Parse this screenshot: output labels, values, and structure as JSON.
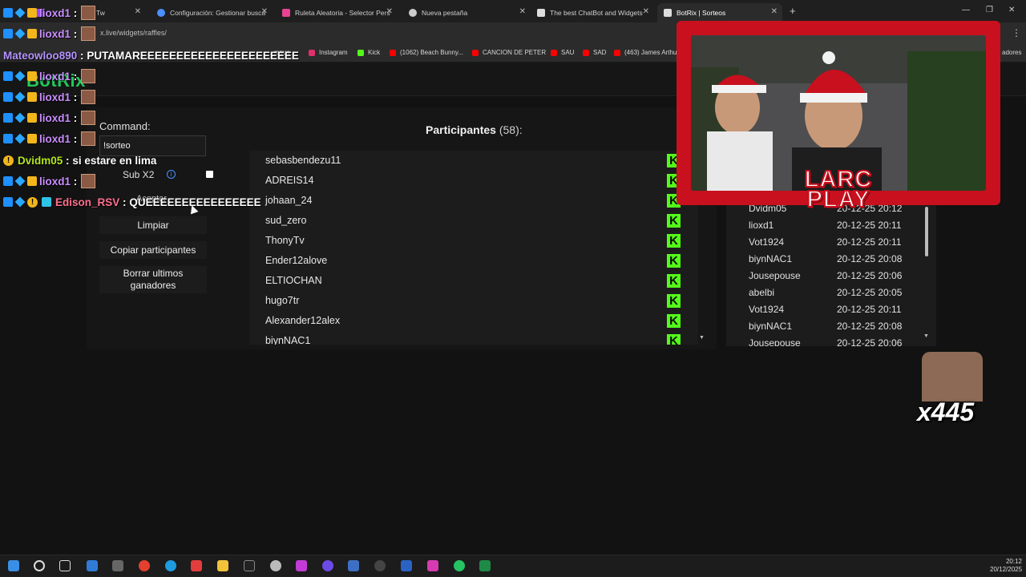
{
  "browser": {
    "tabs": [
      {
        "label": "Tw",
        "color": "#9146ff"
      },
      {
        "label": "Configuración: Gestionar busca",
        "color": "#4a90ff"
      },
      {
        "label": "Ruleta Aleatoria - Selector Pers",
        "color": "#e84393"
      },
      {
        "label": "Nueva pestaña",
        "color": "#cccccc"
      },
      {
        "label": "The best ChatBot and Widgets",
        "color": "#dddddd"
      },
      {
        "label": "BotRix | Sorteos",
        "color": "#dddddd"
      }
    ],
    "url": "x.live/widgets/raffles/",
    "bookmarks": [
      "mpus",
      "Instagram",
      "Kick",
      "(1062) Beach Bunny...",
      "CANCION DE PETER",
      "SAU",
      "SAD",
      "(463) James Arthu",
      "adores"
    ]
  },
  "app": {
    "logo": "BotRix",
    "command_label": "Command:",
    "command_value": "!sorteo",
    "subx2_label": "Sub X2",
    "info_icon": "i",
    "aceptar_label": "Aceptar",
    "limpiar_label": "Limpiar",
    "copiar_label": "Copiar participantes",
    "borrar_label": "Borrar ultimos ganadores",
    "participants_title": "Participantes",
    "participants_count": "(58):",
    "participants": [
      "sebasbendezu11",
      "ADREIS14",
      "johaan_24",
      "sud_zero",
      "ThonyTv",
      "Ender12alove",
      "ELTIOCHAN",
      "hugo7tr",
      "Alexander12alex",
      "biynNAC1"
    ],
    "kick_icon": "K",
    "winners": [
      {
        "name": "Dvidm05",
        "date": "20-12-25 20:12"
      },
      {
        "name": "lioxd1",
        "date": "20-12-25 20:11"
      },
      {
        "name": "Vot1924",
        "date": "20-12-25 20:11"
      },
      {
        "name": "biynNAC1",
        "date": "20-12-25 20:08"
      },
      {
        "name": "Jousepouse",
        "date": "20-12-25 20:06"
      },
      {
        "name": "abelbi",
        "date": "20-12-25 20:05"
      },
      {
        "name": "Vot1924",
        "date": "20-12-25 20:11"
      },
      {
        "name": "biynNAC1",
        "date": "20-12-25 20:08"
      },
      {
        "name": "Jousepouse",
        "date": "20-12-25 20:06"
      }
    ],
    "arrow_down": "▼"
  },
  "chat": [
    {
      "user": "lioxd1",
      "sep": ":",
      "msg": "",
      "badges": "mod-sub-crown",
      "emote": true
    },
    {
      "user": "lioxd1",
      "sep": ":",
      "msg": "",
      "badges": "mod-sub-crown",
      "emote": true
    },
    {
      "user": "Mateowloo890",
      "sep": ":",
      "msg": "PUTAMAREEEEEEEEEEEEEEEEEEEEEE",
      "badges": "",
      "emote": false
    },
    {
      "user": "lioxd1",
      "sep": ":",
      "msg": "",
      "badges": "mod-sub-crown",
      "emote": true
    },
    {
      "user": "lioxd1",
      "sep": ":",
      "msg": "",
      "badges": "mod-sub-crown",
      "emote": true
    },
    {
      "user": "lioxd1",
      "sep": ":",
      "msg": "",
      "badges": "mod-sub-crown",
      "emote": true
    },
    {
      "user": "lioxd1",
      "sep": ":",
      "msg": "",
      "badges": "mod-sub-crown",
      "emote": true
    },
    {
      "user": "Dvidm05",
      "sep": ":",
      "msg": "si estare en lima",
      "badges": "warn",
      "emote": false
    },
    {
      "user": "lioxd1",
      "sep": ":",
      "msg": "",
      "badges": "mod-sub-crown",
      "emote": true
    },
    {
      "user": "Edison_RSV",
      "sep": ":",
      "msg": "QUEEEEEEEEEEEEEEEE",
      "badges": "mod-sub-warn-cat",
      "emote": false
    }
  ],
  "overlay": {
    "cam_logo_line1": "LARC",
    "cam_logo_line2": "PLAY",
    "emote_count": "x445"
  },
  "taskbar": {
    "time": "20:12",
    "date": "20/12/2025"
  }
}
